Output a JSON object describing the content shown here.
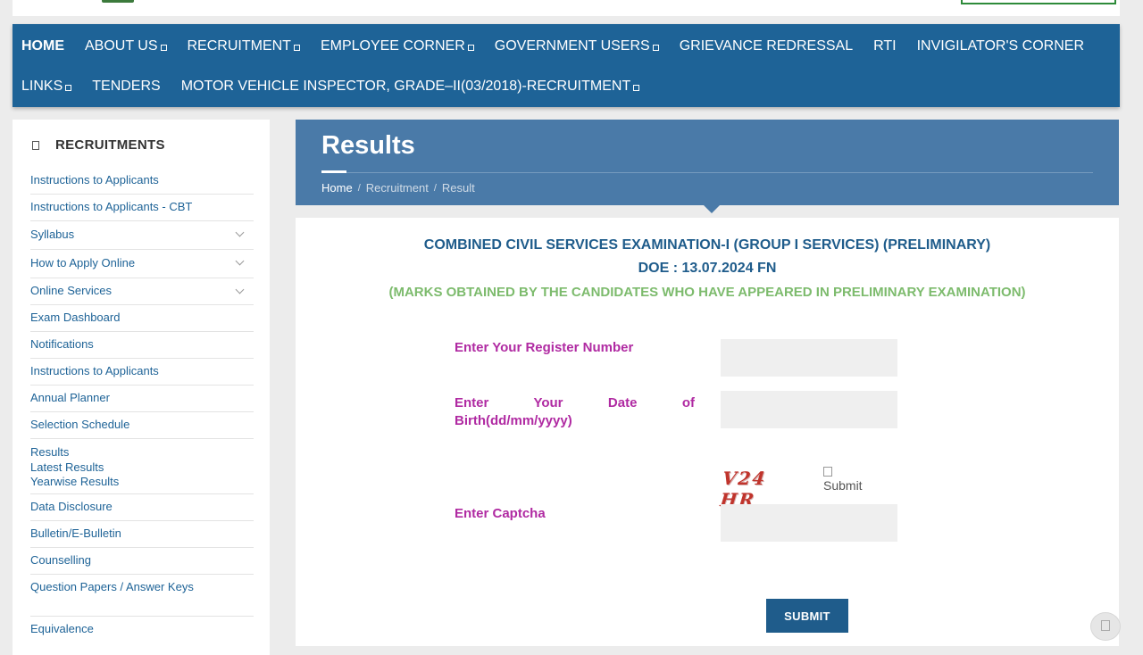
{
  "nav": {
    "row1": [
      {
        "label": "HOME",
        "dropdown": false,
        "active": true
      },
      {
        "label": "ABOUT US",
        "dropdown": true
      },
      {
        "label": "RECRUITMENT",
        "dropdown": true
      },
      {
        "label": "EMPLOYEE CORNER",
        "dropdown": true
      },
      {
        "label": "GOVERNMENT USERS",
        "dropdown": true
      },
      {
        "label": "GRIEVANCE REDRESSAL",
        "dropdown": false
      },
      {
        "label": "RTI",
        "dropdown": false
      },
      {
        "label": "INVIGILATOR'S CORNER",
        "dropdown": false
      }
    ],
    "row2": [
      {
        "label": "LINKS",
        "dropdown": true
      },
      {
        "label": "TENDERS",
        "dropdown": false
      },
      {
        "label": "MOTOR VEHICLE INSPECTOR, GRADE–II(03/2018)-RECRUITMENT",
        "dropdown": true
      }
    ]
  },
  "sidebar": {
    "heading": "RECRUITMENTS",
    "items": [
      {
        "label": "Instructions to Applicants"
      },
      {
        "label": "Instructions to Applicants - CBT"
      },
      {
        "label": "Syllabus",
        "expandable": true
      },
      {
        "label": "How to Apply Online",
        "expandable": true
      },
      {
        "label": "Online Services",
        "expandable": true
      },
      {
        "label": "Exam Dashboard"
      },
      {
        "label": "Notifications"
      },
      {
        "label": "Instructions to Applicants"
      },
      {
        "label": "Annual Planner"
      },
      {
        "label": "Selection Schedule"
      }
    ],
    "results": {
      "label": "Results",
      "sub": [
        "Latest Results",
        "Yearwise Results"
      ]
    },
    "items_after": [
      {
        "label": "Data Disclosure"
      },
      {
        "label": "Bulletin/E-Bulletin"
      },
      {
        "label": "Counselling"
      },
      {
        "label": "Question Papers / Answer Keys"
      }
    ],
    "last": "Equivalence"
  },
  "banner": {
    "title": "Results",
    "breadcrumb": {
      "home": "Home",
      "items": [
        "Recruitment",
        "Result"
      ]
    }
  },
  "exam": {
    "title": "COMBINED CIVIL SERVICES EXAMINATION-I (GROUP I SERVICES) (PRELIMINARY)",
    "date": "DOE : 13.07.2024 FN",
    "note": "(MARKS OBTAINED BY THE CANDIDATES WHO HAVE APPEARED IN PRELIMINARY EXAMINATION)"
  },
  "form": {
    "register_label": "Enter Your Register Number",
    "dob_label_line1": "Enter Your Date of",
    "dob_label_line2": "Birth(dd/mm/yyyy)",
    "captcha_label": "Enter Captcha",
    "captcha_text": "V24 HR",
    "refresh_alt": "Submit",
    "register_value": "",
    "dob_value": "",
    "captcha_value": "",
    "submit_label": "SUBMIT"
  },
  "colors": {
    "nav_bg": "#1e6397",
    "banner_bg": "#4a7aa8",
    "label_color": "#b02aa2",
    "note_color": "#7dbb6d",
    "title_color": "#1f5c8b"
  }
}
